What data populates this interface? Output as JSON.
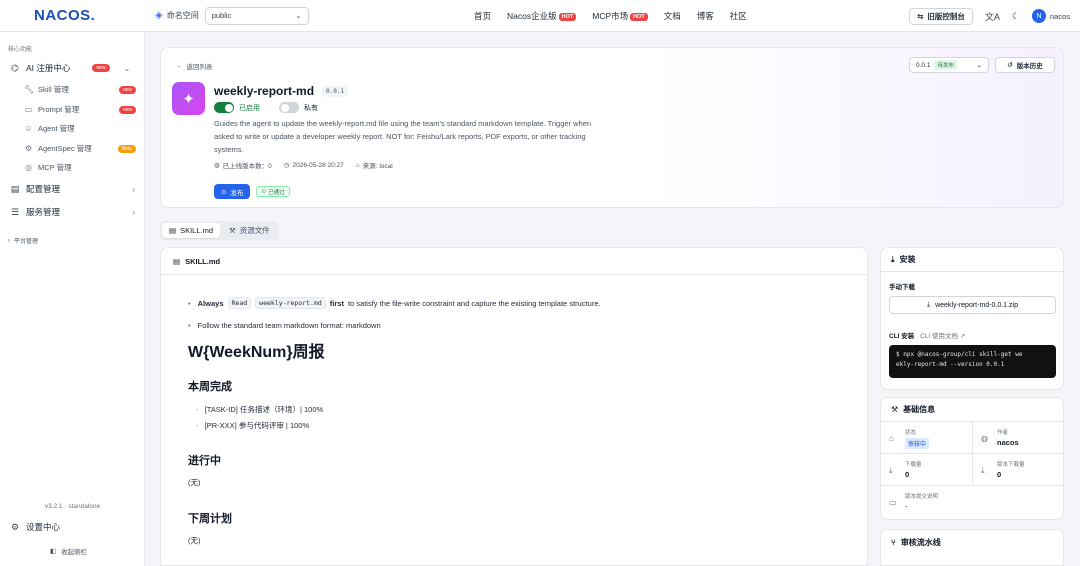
{
  "topbar": {
    "logo": "NACOS.",
    "namespace_label": "命名空间",
    "namespace_value": "public",
    "nav": [
      {
        "label": "首页",
        "hot": ""
      },
      {
        "label": "Nacos企业版",
        "hot": "HOT"
      },
      {
        "label": "MCP市场",
        "hot": "HOT"
      },
      {
        "label": "文档",
        "hot": ""
      },
      {
        "label": "博客",
        "hot": ""
      },
      {
        "label": "社区",
        "hot": ""
      }
    ],
    "old_console": "旧版控制台",
    "avatar_letter": "N",
    "username": "nacos"
  },
  "sidebar": {
    "section": "核心功能",
    "ai_center": "AI 注册中心",
    "ai_badge": "new",
    "subs": [
      {
        "label": "Skill 管理",
        "badge": "new"
      },
      {
        "label": "Prompt 管理",
        "badge": "new"
      },
      {
        "label": "Agent 管理",
        "badge": ""
      },
      {
        "label": "AgentSpec 管理",
        "badge": "Beta"
      },
      {
        "label": "MCP 管理",
        "badge": ""
      }
    ],
    "config": "配置管理",
    "service": "服务管理",
    "platform": "平台管理",
    "version": "v3.2.1 · standalone",
    "settings": "设置中心",
    "collapse": "收起侧栏"
  },
  "header": {
    "back": "返回列表",
    "name": "weekly-report-md",
    "version_tag": "0.0.1",
    "enabled": "已启用",
    "private": "私有",
    "description": "Guides the agent to update the weekly-report.md file using the team's standard markdown template. Trigger when asked to write or update a developer weekly report. NOT for: Feishu/Lark reports, PDF exports, or other tracking systems.",
    "online_versions": "已上线版本数：0",
    "date": "2026-05-28 20:27",
    "source": "来源: local",
    "publish": "发布",
    "passed": "已通过",
    "version_select": "0.0.1",
    "version_status": "待发布",
    "history": "版本历史"
  },
  "tabs": [
    "SKILL.md",
    "资源文件"
  ],
  "content": {
    "file": "SKILL.md",
    "line1_a": "Always",
    "line1_code1": "Read",
    "line1_code2": "weekly-report.md",
    "line1_b": "first",
    "line1_c": "to satisfy the file-write constraint and capture the existing template structure.",
    "line2": "Follow the standard team markdown format: markdown",
    "h1": "W{WeekNum}周报",
    "h_done": "本周完成",
    "done_items": [
      "[TASK-ID] 任务描述（环境）| 100%",
      "[PR-XXX] 参与代码评审 | 100%"
    ],
    "h_progress": "进行中",
    "progress_text": "(无)",
    "h_next": "下周计划",
    "next_text": "(无)"
  },
  "install": {
    "title": "安装",
    "manual": "手动下载",
    "zip": "weekly-report-md-0.0.1.zip",
    "cli": "CLI 安装",
    "cli_doc": "CLI 使用文档",
    "cmd_line1": "$ npx @nacos-group/cli skill-get we",
    "cmd_line2": "ekly-report-md --version 0.0.1"
  },
  "basic": {
    "title": "基础信息",
    "status_k": "状态",
    "status_v": "审核中",
    "author_k": "作者",
    "author_v": "nacos",
    "dl_k": "下载量",
    "dl_v": "0",
    "vdl_k": "版本下载量",
    "vdl_v": "0",
    "note_k": "版本提交说明",
    "note_v": "-"
  },
  "pipeline": {
    "title": "审核流水线"
  },
  "colors": {
    "primary": "#2563eb",
    "success": "#15803d",
    "hot": "#ef4444"
  }
}
